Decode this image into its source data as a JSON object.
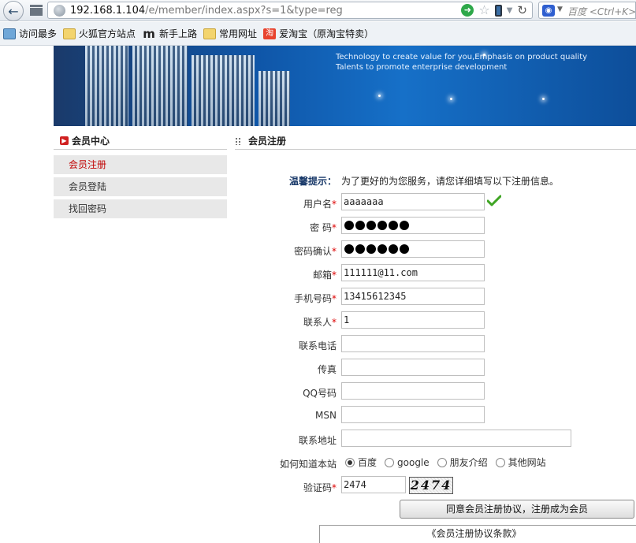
{
  "browser": {
    "url_host": "192.168.1.104",
    "url_path": "/e/member/index.aspx?s=1&type=reg",
    "search_placeholder": "百度 <Ctrl+K>"
  },
  "bookmarks": [
    {
      "label": "访问最多",
      "icon": "most-visited-icon"
    },
    {
      "label": "火狐官方站点",
      "icon": "folder-icon"
    },
    {
      "label": "新手上路",
      "icon": "m-logo-icon"
    },
    {
      "label": "常用网址",
      "icon": "folder-icon"
    },
    {
      "label": "爱淘宝（原淘宝特卖）",
      "icon": "taobao-icon"
    }
  ],
  "banner": {
    "line1": "Technology to create value for you,Emphasis on product quality",
    "line2": "Talents to promote enterprise development"
  },
  "sidebar": {
    "title": "会员中心",
    "items": [
      {
        "label": "会员注册",
        "active": true
      },
      {
        "label": "会员登陆",
        "active": false
      },
      {
        "label": "找回密码",
        "active": false
      }
    ]
  },
  "main": {
    "title": "会员注册",
    "hint_label": "温馨提示：",
    "hint_text": "为了更好的为您服务，请您详细填写以下注册信息。"
  },
  "form": {
    "username": {
      "label": "用户名",
      "required": "*",
      "value": "aaaaaaa"
    },
    "password": {
      "label": "密  码",
      "required": "*",
      "dots": 6
    },
    "password_confirm": {
      "label": "密码确认",
      "required": "*",
      "dots": 6
    },
    "email": {
      "label": "邮箱",
      "required": "*",
      "value": "111111@11.com"
    },
    "mobile": {
      "label": "手机号码",
      "required": "*",
      "value": "13415612345"
    },
    "contact": {
      "label": "联系人",
      "required": "*",
      "value": "1"
    },
    "phone": {
      "label": "联系电话",
      "value": ""
    },
    "fax": {
      "label": "传真",
      "value": ""
    },
    "qq": {
      "label": "QQ号码",
      "value": ""
    },
    "msn": {
      "label": "MSN",
      "value": ""
    },
    "address": {
      "label": "联系地址",
      "value": ""
    },
    "source": {
      "label": "如何知道本站",
      "options": [
        "百度",
        "google",
        "朋友介绍",
        "其他网站"
      ],
      "selected": "百度"
    },
    "captcha": {
      "label": "验证码",
      "required": "*",
      "value": "2474",
      "image_text": "2474"
    },
    "submit_label": "同意会员注册协议，注册成为会员",
    "terms_label": "《会员注册协议条款》"
  }
}
